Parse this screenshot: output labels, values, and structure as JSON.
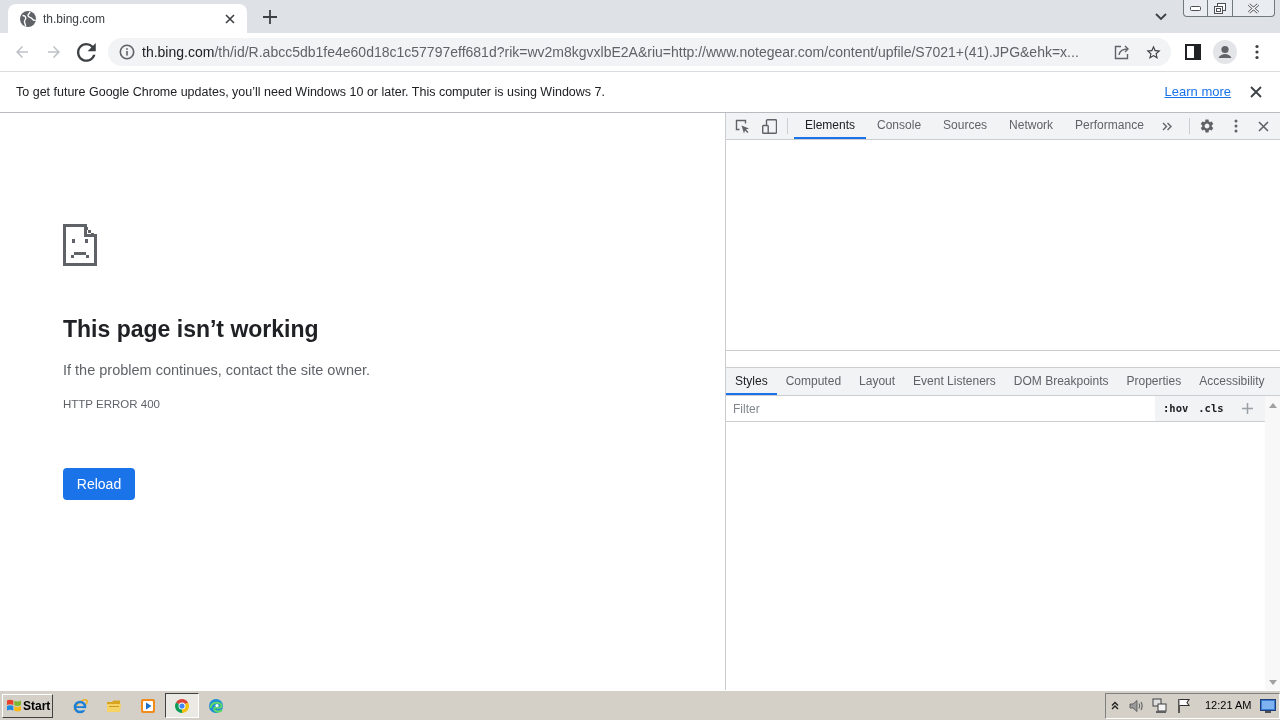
{
  "browser_tabs": [
    {
      "title": "th.bing.com",
      "selected": true
    }
  ],
  "address_bar": {
    "host": "th.bing.com",
    "path": "/th/id/R.abcc5db1fe4e60d18c1c57797eff681d?rik=wv2m8kgvxlbE2A&riu=http://www.notegear.com/content/upfile/S7021+(41).JPG&ehk=x..."
  },
  "infobar": {
    "message": "To get future Google Chrome updates, you’ll need Windows 10 or later. This computer is using Windows 7.",
    "link": "Learn more"
  },
  "error_page": {
    "heading": "This page isn’t working",
    "message": "If the problem continues, contact the site owner.",
    "error_code": "HTTP ERROR 400",
    "button": "Reload"
  },
  "devtools": {
    "tabs": [
      {
        "label": "Elements",
        "selected": true
      },
      {
        "label": "Console",
        "selected": false
      },
      {
        "label": "Sources",
        "selected": false
      },
      {
        "label": "Network",
        "selected": false
      },
      {
        "label": "Performance",
        "selected": false
      }
    ],
    "styles_tabs": [
      {
        "label": "Styles",
        "selected": true
      },
      {
        "label": "Computed",
        "selected": false
      },
      {
        "label": "Layout",
        "selected": false
      },
      {
        "label": "Event Listeners",
        "selected": false
      },
      {
        "label": "DOM Breakpoints",
        "selected": false
      },
      {
        "label": "Properties",
        "selected": false
      },
      {
        "label": "Accessibility",
        "selected": false
      }
    ],
    "filter": {
      "placeholder": "Filter"
    },
    "toggles": [
      ":hov",
      ".cls"
    ]
  },
  "taskbar": {
    "start": "Start",
    "apps": [
      {
        "kind": "e-logo",
        "selected": false
      },
      {
        "kind": "folder",
        "selected": false
      },
      {
        "kind": "play-tile",
        "selected": false
      },
      {
        "kind": "ring-logo",
        "selected": true
      },
      {
        "kind": "swirl-logo",
        "selected": false
      }
    ],
    "clock": "12:21 AM"
  }
}
